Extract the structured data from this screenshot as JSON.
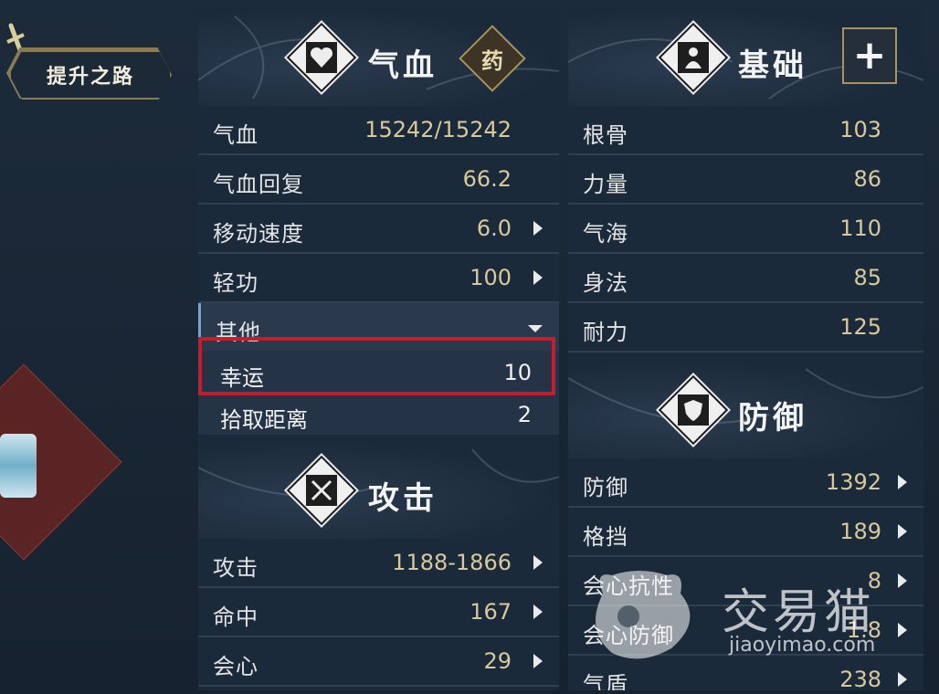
{
  "left": {
    "road_label": "提升之路"
  },
  "hp_section": {
    "title": "气血",
    "medicine_label": "药",
    "rows": [
      {
        "label": "气血",
        "value": "15242/15242"
      },
      {
        "label": "气血回复",
        "value": "66.2"
      },
      {
        "label": "移动速度",
        "value": "6.0"
      },
      {
        "label": "轻功",
        "value": "100"
      }
    ],
    "other": {
      "label": "其他",
      "items": [
        {
          "label": "幸运",
          "value": "10"
        },
        {
          "label": "拾取距离",
          "value": "2"
        }
      ]
    }
  },
  "attack_section": {
    "title": "攻击",
    "rows": [
      {
        "label": "攻击",
        "value": "1188-1866"
      },
      {
        "label": "命中",
        "value": "167"
      },
      {
        "label": "会心",
        "value": "29"
      }
    ]
  },
  "base_section": {
    "title": "基础",
    "plus_label": "+",
    "rows": [
      {
        "label": "根骨",
        "value": "103"
      },
      {
        "label": "力量",
        "value": "86"
      },
      {
        "label": "气海",
        "value": "110"
      },
      {
        "label": "身法",
        "value": "85"
      },
      {
        "label": "耐力",
        "value": "125"
      }
    ]
  },
  "defense_section": {
    "title": "防御",
    "rows": [
      {
        "label": "防御",
        "value": "1392"
      },
      {
        "label": "格挡",
        "value": "189"
      },
      {
        "label": "会心抗性",
        "value": "8"
      },
      {
        "label": "会心防御",
        "value": "1.8"
      },
      {
        "label": "气盾",
        "value": "238"
      }
    ]
  },
  "watermark": {
    "brand": "交易猫",
    "url": "jiaoyimao.com"
  }
}
